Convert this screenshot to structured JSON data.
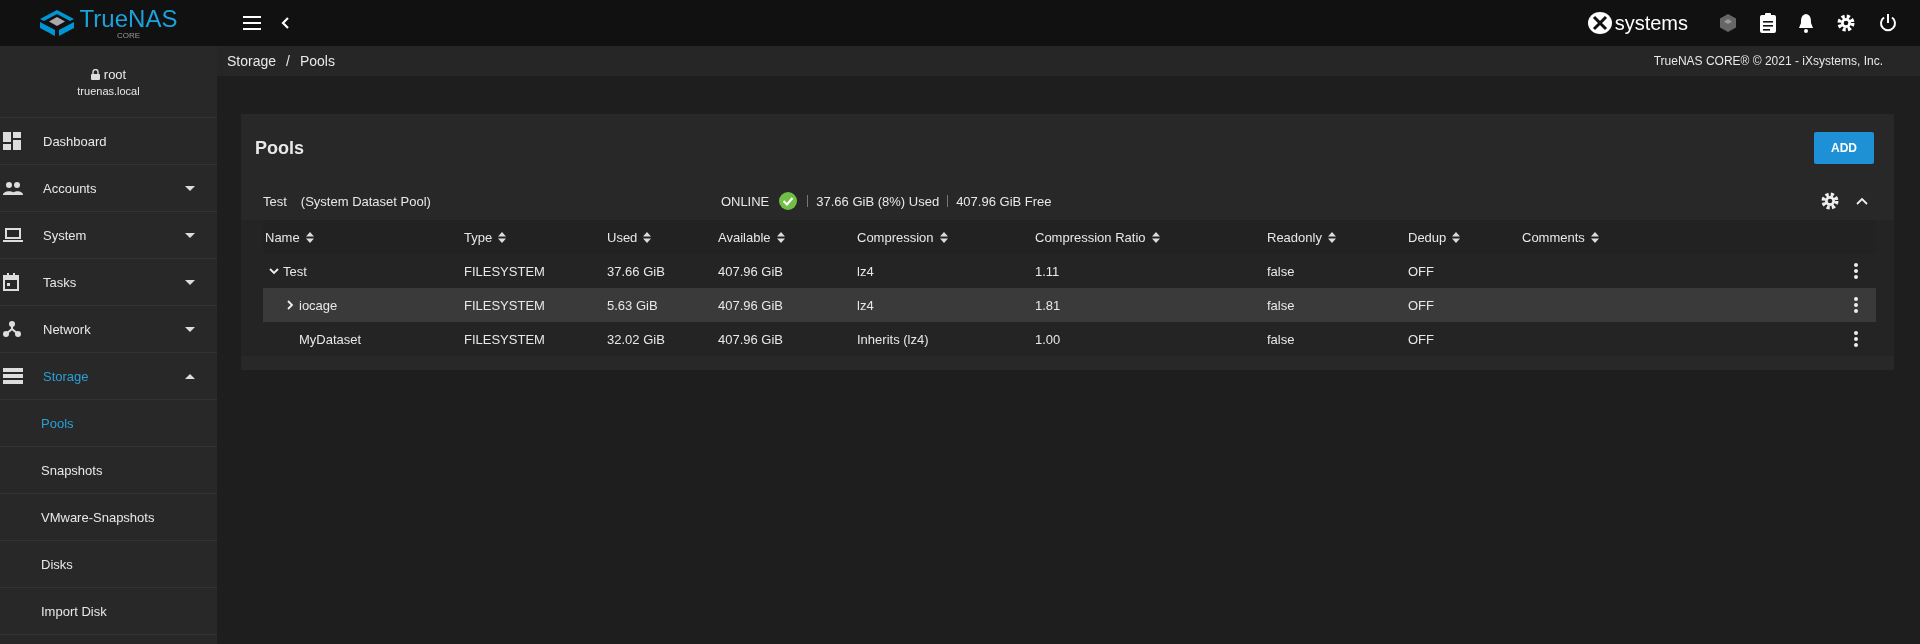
{
  "topbar": {
    "logo_text": "TrueNAS",
    "logo_sub": "CORE",
    "brand": "systems"
  },
  "breadcrumb": [
    "Storage",
    "Pools"
  ],
  "breadcrumb_separator": "/",
  "copyright": "TrueNAS CORE® © 2021 - iXsystems, Inc.",
  "user": {
    "name": "root",
    "host": "truenas.local"
  },
  "sidebar": {
    "items": [
      {
        "label": "Dashboard",
        "selected": false
      },
      {
        "label": "Accounts",
        "selected": false,
        "expanded": false
      },
      {
        "label": "System",
        "selected": false,
        "expanded": false
      },
      {
        "label": "Tasks",
        "selected": false,
        "expanded": false
      },
      {
        "label": "Network",
        "selected": false,
        "expanded": false
      },
      {
        "label": "Storage",
        "selected": true,
        "expanded": true,
        "children": [
          {
            "label": "Pools",
            "selected": true
          },
          {
            "label": "Snapshots",
            "selected": false
          },
          {
            "label": "VMware-Snapshots",
            "selected": false
          },
          {
            "label": "Disks",
            "selected": false
          },
          {
            "label": "Import Disk",
            "selected": false
          }
        ]
      }
    ]
  },
  "page": {
    "title": "Pools",
    "add_button": "ADD"
  },
  "pool": {
    "name": "Test",
    "note": "(System Dataset Pool)",
    "status": "ONLINE",
    "healthy": true,
    "used": "37.66 GiB (8%) Used",
    "free": "407.96 GiB Free",
    "expanded": true
  },
  "table": {
    "columns": [
      "Name",
      "Type",
      "Used",
      "Available",
      "Compression",
      "Compression Ratio",
      "Readonly",
      "Dedup",
      "Comments"
    ],
    "rows": [
      {
        "cells": [
          "Test",
          "FILESYSTEM",
          "37.66 GiB",
          "407.96 GiB",
          "lz4",
          "1.11",
          "false",
          "OFF"
        ],
        "expanded": true,
        "selected": false,
        "children": [
          {
            "cells": [
              "iocage",
              "FILESYSTEM",
              "5.63 GiB",
              "407.96 GiB",
              "lz4",
              "1.81",
              "false",
              "OFF"
            ],
            "expanded": false,
            "selected": true
          },
          {
            "cells": [
              "MyDataset",
              "FILESYSTEM",
              "32.02 GiB",
              "407.96 GiB",
              "Inherits (lz4)",
              "1.00",
              "false",
              "OFF"
            ],
            "selected": false
          }
        ]
      }
    ]
  }
}
